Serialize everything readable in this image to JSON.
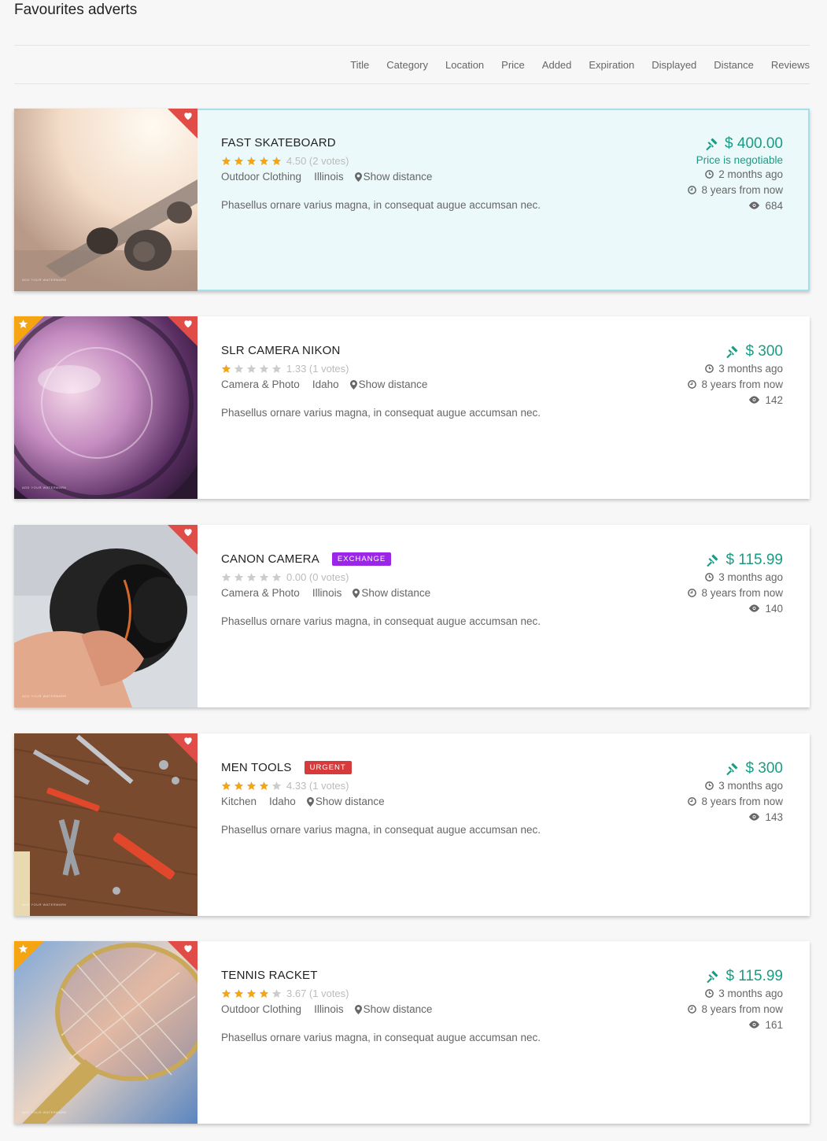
{
  "page_title": "Favourites adverts",
  "sort_options": [
    "Title",
    "Category",
    "Location",
    "Price",
    "Added",
    "Expiration",
    "Displayed",
    "Distance",
    "Reviews"
  ],
  "colors": {
    "accent": "#1a9c84",
    "favourite": "#e04c47",
    "featured": "#f5a412",
    "star_on": "#f5a412",
    "star_off": "#cccccc",
    "highlight_bg": "#ebf9fb"
  },
  "adverts": [
    {
      "title": "FAST SKATEBOARD",
      "badge": "",
      "badge_color": "",
      "rating": 4.5,
      "rating_text": "4.50 (2 votes)",
      "category": "Outdoor Clothing",
      "location": "Illinois",
      "distance_label": "Show distance",
      "description": "Phasellus ornare varius magna, in consequat augue accumsan nec.",
      "price": "$ 400.00",
      "negotiable": "Price is negotiable",
      "added": "2 months ago",
      "expires": "8 years from now",
      "views": "684",
      "featured": false,
      "highlighted": true,
      "image": "skateboard",
      "watermark": "ADD YOUR WATERMARK"
    },
    {
      "title": "SLR CAMERA NIKON",
      "badge": "",
      "badge_color": "",
      "rating": 1.33,
      "rating_text": "1.33 (1 votes)",
      "category": "Camera & Photo",
      "location": "Idaho",
      "distance_label": "Show distance",
      "description": "Phasellus ornare varius magna, in consequat augue accumsan nec.",
      "price": "$ 300",
      "negotiable": "",
      "added": "3 months ago",
      "expires": "8 years from now",
      "views": "142",
      "featured": true,
      "highlighted": false,
      "image": "camera-lens",
      "watermark": "ADD YOUR WATERMARK"
    },
    {
      "title": "CANON CAMERA",
      "badge": "EXCHANGE",
      "badge_color": "#9b26e8",
      "rating": 0,
      "rating_text": "0.00 (0 votes)",
      "category": "Camera & Photo",
      "location": "Illinois",
      "distance_label": "Show distance",
      "description": "Phasellus ornare varius magna, in consequat augue accumsan nec.",
      "price": "$ 115.99",
      "negotiable": "",
      "added": "3 months ago",
      "expires": "8 years from now",
      "views": "140",
      "featured": false,
      "highlighted": false,
      "image": "camera-hand",
      "watermark": "ADD YOUR WATERMARK"
    },
    {
      "title": "MEN TOOLS",
      "badge": "URGENT",
      "badge_color": "#d63a3a",
      "rating": 4.33,
      "rating_text": "4.33 (1 votes)",
      "category": "Kitchen",
      "location": "Idaho",
      "distance_label": "Show distance",
      "description": "Phasellus ornare varius magna, in consequat augue accumsan nec.",
      "price": "$ 300",
      "negotiable": "",
      "added": "3 months ago",
      "expires": "8 years from now",
      "views": "143",
      "featured": false,
      "highlighted": false,
      "image": "tools",
      "watermark": "ADD YOUR WATERMARK"
    },
    {
      "title": "TENNIS RACKET",
      "badge": "",
      "badge_color": "",
      "rating": 3.67,
      "rating_text": "3.67 (1 votes)",
      "category": "Outdoor Clothing",
      "location": "Illinois",
      "distance_label": "Show distance",
      "description": "Phasellus ornare varius magna, in consequat augue accumsan nec.",
      "price": "$ 115.99",
      "negotiable": "",
      "added": "3 months ago",
      "expires": "8 years from now",
      "views": "161",
      "featured": true,
      "highlighted": false,
      "image": "racket",
      "watermark": "ADD YOUR WATERMARK"
    }
  ]
}
